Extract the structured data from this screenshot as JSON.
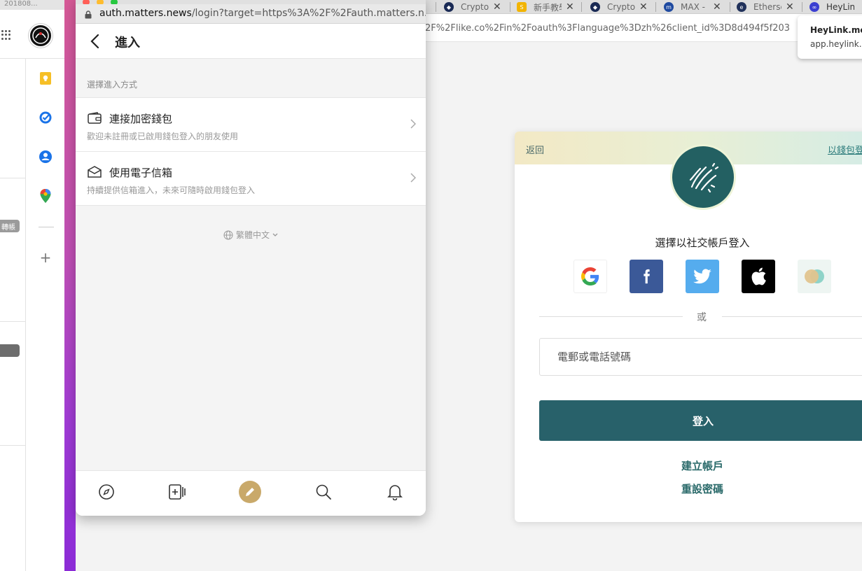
{
  "colors": {
    "accent_teal": "#28616a",
    "link_teal": "#2a6a6a",
    "compose_gold": "#c9a96a",
    "facebook_blue": "#3b5998",
    "twitter_blue": "#55acee",
    "apple_black": "#000000"
  },
  "left_window": {
    "tab_fragment": "201808...",
    "tag_text": "轉帳",
    "rail_icons": [
      "keep-icon",
      "tasks-icon",
      "contacts-icon",
      "maps-icon",
      "plus-icon"
    ]
  },
  "background_browser": {
    "tabs": [
      {
        "label": "Crypto",
        "icon": "crypto-com-icon"
      },
      {
        "label": "新手教學",
        "icon": "sparkle-icon"
      },
      {
        "label": "Crypto",
        "icon": "crypto-com-icon"
      },
      {
        "label": "MAX - ",
        "icon": "max-icon"
      },
      {
        "label": "Etherscan",
        "icon": "etherscan-icon"
      },
      {
        "label": "HeyLink",
        "icon": "heylink-icon"
      }
    ],
    "url": "2F%2Flike.co%2Fin%2Foauth%3Flanguage%3Dzh%26client_id%3D8d494f5f203",
    "tooltip": {
      "title": "HeyLink.me",
      "domain": "app.heylink.me"
    }
  },
  "login_card": {
    "back": "返回",
    "wallet_login": "以錢包登入",
    "title": "選擇以社交帳戶登入",
    "providers": [
      "google-icon",
      "facebook-icon",
      "twitter-icon",
      "apple-icon",
      "liker-land-icon"
    ],
    "or": "或",
    "input_placeholder": "電郵或電話號碼",
    "submit": "登入",
    "create_account": "建立帳戶",
    "reset_password": "重設密碼"
  },
  "popup": {
    "url_domain": "auth.matters.news",
    "url_path": "/login?target=https%3A%2F%2Fauth.matters.n...",
    "title": "進入",
    "section_label": "選擇進入方式",
    "options": [
      {
        "title": "連接加密錢包",
        "subtitle": "歡迎未註冊或已啟用錢包登入的朋友使用"
      },
      {
        "title": "使用電子信箱",
        "subtitle": "持續提供信箱進入，未來可隨時啟用錢包登入"
      }
    ],
    "language": "繁體中文",
    "bottom_nav": [
      "discover-icon",
      "follow-icon",
      "compose-icon",
      "search-icon",
      "bell-icon"
    ]
  }
}
